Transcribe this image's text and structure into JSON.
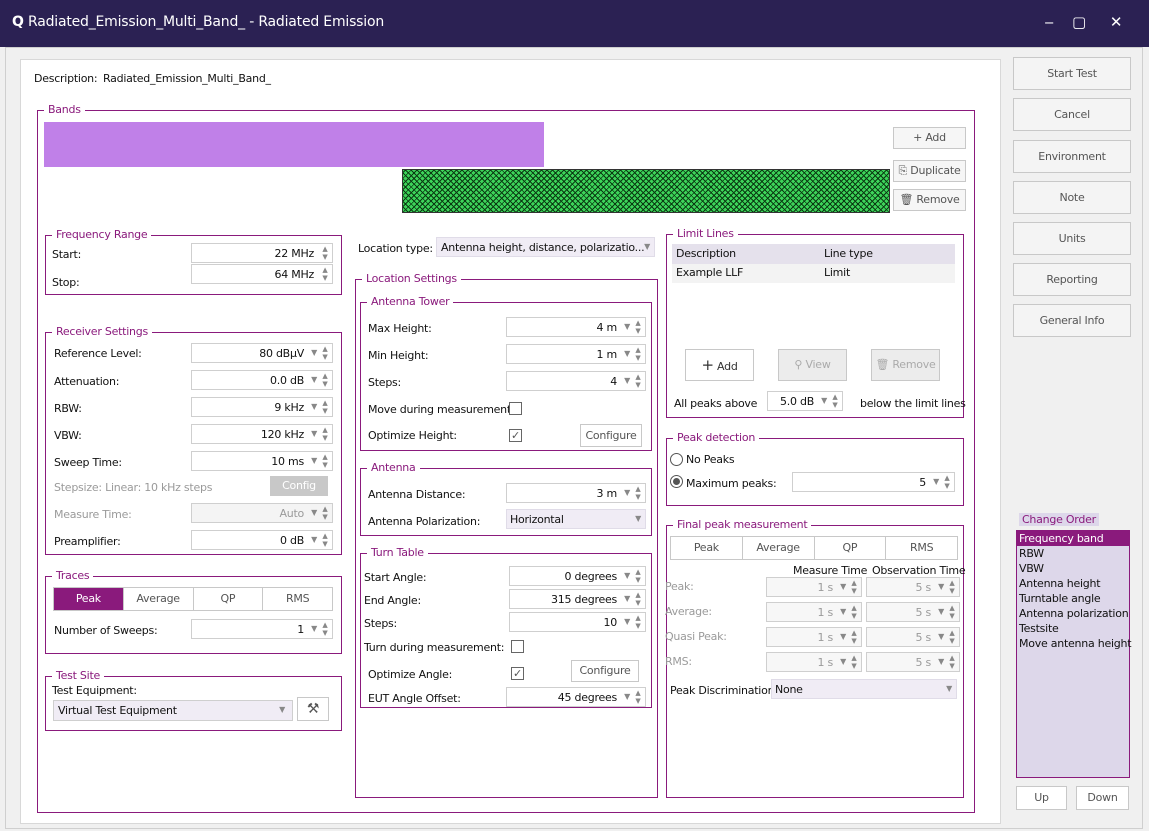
{
  "window": {
    "title": "Radiated_Emission_Multi_Band_ - Radiated Emission",
    "minimize": "‒",
    "maximize": "▢",
    "close": "✕"
  },
  "description": {
    "label": "Description:",
    "value": "Radiated_Emission_Multi_Band_"
  },
  "bands": {
    "title": "Bands",
    "add": "+ Add",
    "duplicate": "⎘ Duplicate",
    "remove": "🗑 Remove"
  },
  "frequency_range": {
    "title": "Frequency Range",
    "start_label": "Start:",
    "start_value": "22 MHz",
    "stop_label": "Stop:",
    "stop_value": "64 MHz"
  },
  "receiver": {
    "title": "Receiver Settings",
    "ref_label": "Reference Level:",
    "ref_value": "80 dBµV",
    "att_label": "Attenuation:",
    "att_value": "0.0 dB",
    "rbw_label": "RBW:",
    "rbw_value": "9 kHz",
    "vbw_label": "VBW:",
    "vbw_value": "120 kHz",
    "sweep_label": "Sweep Time:",
    "sweep_value": "10 ms",
    "stepsize_label": "Stepsize: Linear: 10 kHz steps",
    "config": "Config",
    "measure_label": "Measure Time:",
    "measure_value": "Auto",
    "preamp_label": "Preamplifier:",
    "preamp_value": "0 dB"
  },
  "traces": {
    "title": "Traces",
    "tabs": [
      "Peak",
      "Average",
      "QP",
      "RMS"
    ],
    "sweeps_label": "Number of Sweeps:",
    "sweeps_value": "1"
  },
  "test_site": {
    "title": "Test Site",
    "equipment_label": "Test Equipment:",
    "equipment_value": "Virtual Test Equipment"
  },
  "location": {
    "type_label": "Location type:",
    "type_value": "Antenna height, distance, polarizatio...",
    "settings_title": "Location Settings",
    "tower": {
      "title": "Antenna Tower",
      "max_label": "Max Height:",
      "max_value": "4 m",
      "min_label": "Min Height:",
      "min_value": "1 m",
      "steps_label": "Steps:",
      "steps_value": "4",
      "move_label": "Move during measurement:",
      "optimize_label": "Optimize Height:",
      "configure": "Configure"
    },
    "antenna": {
      "title": "Antenna",
      "distance_label": "Antenna Distance:",
      "distance_value": "3 m",
      "pol_label": "Antenna Polarization:",
      "pol_value": "Horizontal"
    },
    "turntable": {
      "title": "Turn Table",
      "start_label": "Start Angle:",
      "start_value": "0 degrees",
      "end_label": "End Angle:",
      "end_value": "315 degrees",
      "steps_label": "Steps:",
      "steps_value": "10",
      "turn_label": "Turn during measurement:",
      "optimize_label": "Optimize Angle:",
      "configure": "Configure",
      "offset_label": "EUT Angle Offset:",
      "offset_value": "45 degrees"
    }
  },
  "limit_lines": {
    "title": "Limit Lines",
    "headers": [
      "Description",
      "Line type"
    ],
    "rows": [
      [
        "Example LLF",
        "Limit"
      ]
    ],
    "add": "Add",
    "view": "View",
    "remove": "Remove",
    "above_label": "All peaks above",
    "above_value": "5.0 dB",
    "below_label": "below the limit lines"
  },
  "peak_detection": {
    "title": "Peak detection",
    "no_peaks": "No Peaks",
    "max_peaks": "Maximum peaks:",
    "max_value": "5"
  },
  "final_peak": {
    "title": "Final peak measurement",
    "tabs": [
      "Peak",
      "Average",
      "QP",
      "RMS"
    ],
    "col_measure": "Measure Time",
    "col_obs": "Observation Time",
    "rows": [
      {
        "label": "Peak:",
        "measure": "1 s",
        "obs": "5 s"
      },
      {
        "label": "Average:",
        "measure": "1 s",
        "obs": "5 s"
      },
      {
        "label": "Quasi Peak:",
        "measure": "1 s",
        "obs": "5 s"
      },
      {
        "label": "RMS:",
        "measure": "1 s",
        "obs": "5 s"
      }
    ],
    "discrimination_label": "Peak Discrimination:",
    "discrimination_value": "None"
  },
  "side_buttons": [
    "Start Test",
    "Cancel",
    "Environment",
    "Note",
    "Units",
    "Reporting",
    "General Info"
  ],
  "change_order": {
    "title": "Change Order",
    "items": [
      "Frequency band",
      "RBW",
      "VBW",
      "Antenna height",
      "Turntable angle",
      "Antenna polarization",
      "Testsite",
      "Move antenna height"
    ],
    "up": "Up",
    "down": "Down"
  },
  "colors": {
    "accent": "#8a1a7c",
    "titlebar": "#2b2153",
    "band_lavender": "#c080e8",
    "band_green": "#3dd45a"
  }
}
